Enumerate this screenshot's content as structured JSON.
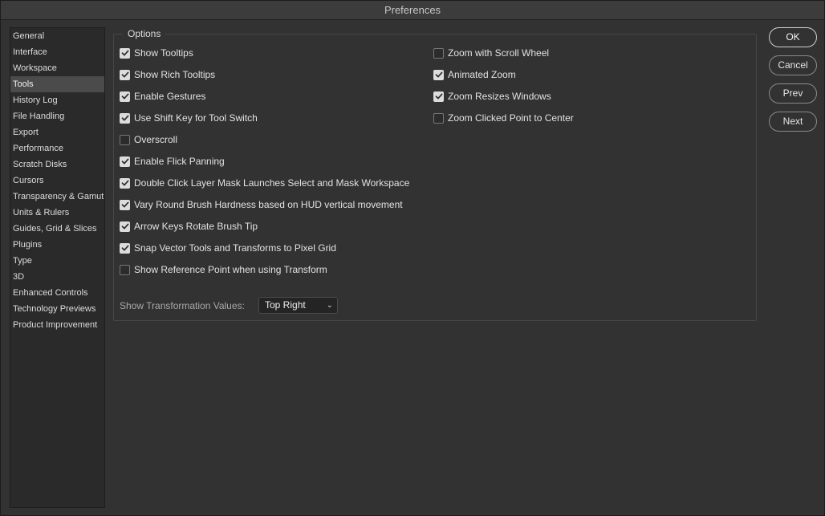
{
  "window": {
    "title": "Preferences"
  },
  "sidebar": {
    "items": [
      {
        "label": "General"
      },
      {
        "label": "Interface"
      },
      {
        "label": "Workspace"
      },
      {
        "label": "Tools",
        "active": true
      },
      {
        "label": "History Log"
      },
      {
        "label": "File Handling"
      },
      {
        "label": "Export"
      },
      {
        "label": "Performance"
      },
      {
        "label": "Scratch Disks"
      },
      {
        "label": "Cursors"
      },
      {
        "label": "Transparency & Gamut"
      },
      {
        "label": "Units & Rulers"
      },
      {
        "label": "Guides, Grid & Slices"
      },
      {
        "label": "Plugins"
      },
      {
        "label": "Type"
      },
      {
        "label": "3D"
      },
      {
        "label": "Enhanced Controls"
      },
      {
        "label": "Technology Previews"
      },
      {
        "label": "Product Improvement"
      }
    ]
  },
  "options": {
    "title": "Options",
    "left": [
      {
        "label": "Show Tooltips",
        "checked": true
      },
      {
        "label": "Show Rich Tooltips",
        "checked": true
      },
      {
        "label": "Enable Gestures",
        "checked": true
      },
      {
        "label": "Use Shift Key for Tool Switch",
        "checked": true
      },
      {
        "label": "Overscroll",
        "checked": false
      },
      {
        "label": "Enable Flick Panning",
        "checked": true
      },
      {
        "label": "Double Click Layer Mask Launches Select and Mask Workspace",
        "checked": true
      },
      {
        "label": "Vary Round Brush Hardness based on HUD vertical movement",
        "checked": true
      },
      {
        "label": "Arrow Keys Rotate Brush Tip",
        "checked": true
      },
      {
        "label": "Snap Vector Tools and Transforms to Pixel Grid",
        "checked": true
      },
      {
        "label": "Show Reference Point when using Transform",
        "checked": false
      }
    ],
    "right": [
      {
        "label": "Zoom with Scroll Wheel",
        "checked": false
      },
      {
        "label": "Animated Zoom",
        "checked": true
      },
      {
        "label": "Zoom Resizes Windows",
        "checked": true
      },
      {
        "label": "Zoom Clicked Point to Center",
        "checked": false
      }
    ],
    "transformation_values": {
      "label": "Show Transformation Values:",
      "selected": "Top Right"
    }
  },
  "buttons": {
    "ok": "OK",
    "cancel": "Cancel",
    "prev": "Prev",
    "next": "Next"
  },
  "icons": {
    "checkmark": "checkmark-icon",
    "chevron": "chevron-down-icon"
  }
}
